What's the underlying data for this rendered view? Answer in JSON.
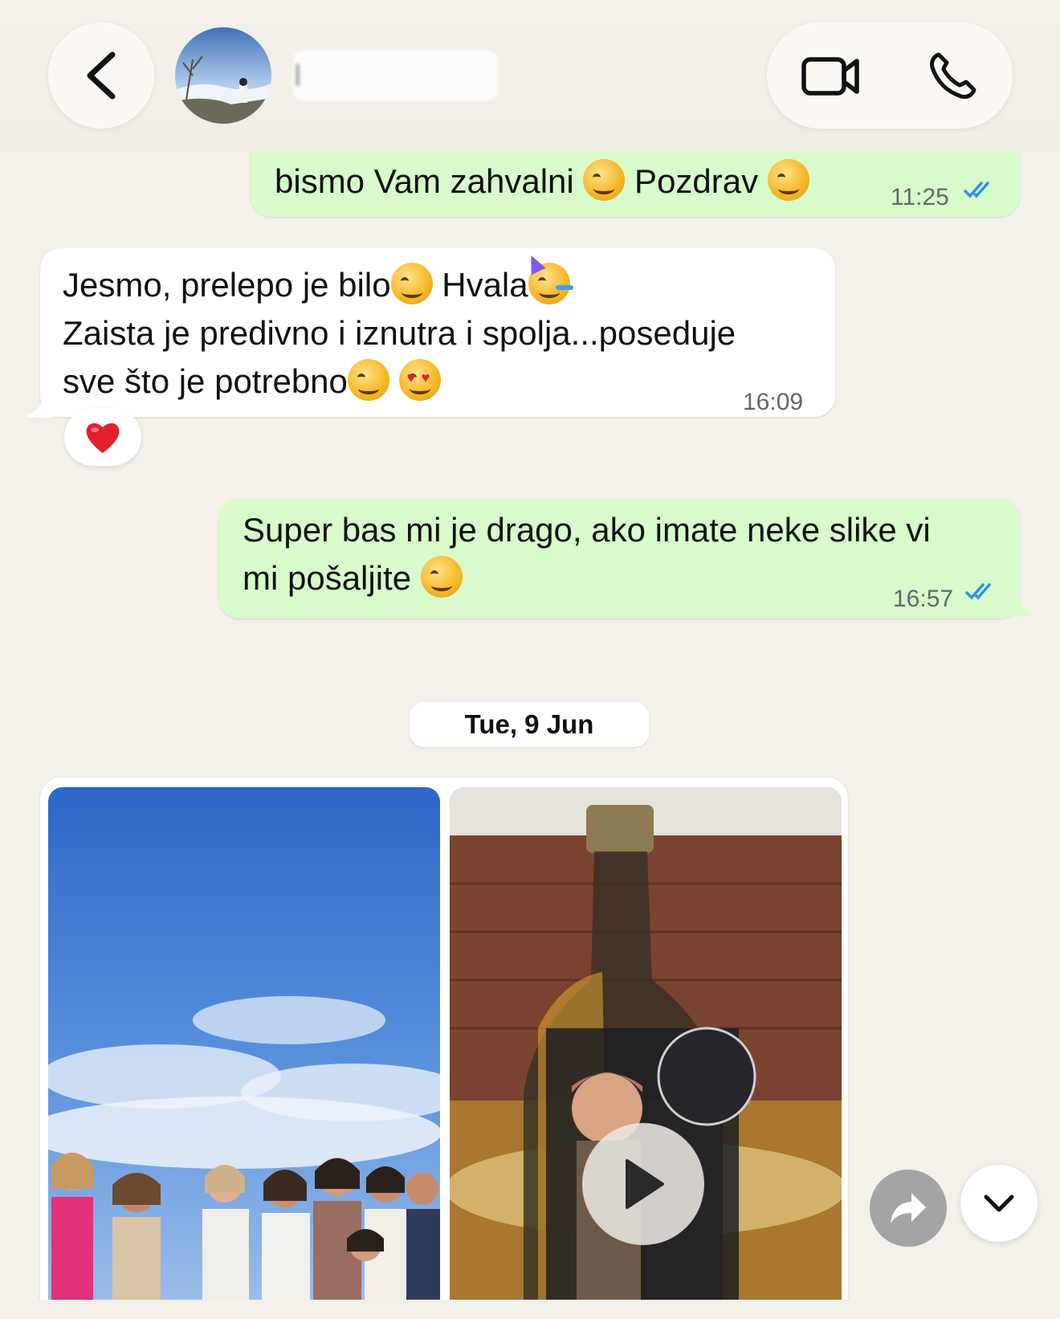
{
  "header": {
    "contact_name": "I",
    "back_icon": "chevron-left-icon",
    "video_call_icon": "video-camera-icon",
    "voice_call_icon": "phone-icon"
  },
  "messages": [
    {
      "direction": "out",
      "text_parts": [
        "bismo Vam zahvalni ",
        " Pozdrav "
      ],
      "emojis": [
        "smiling-face",
        "smiling-face"
      ],
      "time": "11:25",
      "status": "read"
    },
    {
      "direction": "in",
      "line1_a": "Jesmo, prelepo je bilo",
      "line1_b": " Hvala",
      "line2": "Zaista je predivno i iznutra i spolja...poseduje",
      "line3": "sve što je potrebno",
      "emojis": [
        "smiling-face",
        "party-face",
        "relieved-face",
        "heart-eyes-face"
      ],
      "time": "16:09",
      "reaction": "red-heart"
    },
    {
      "direction": "out",
      "line1": "Super bas mi je drago, ako imate neke slike vi",
      "line2": "mi pošaljite ",
      "emojis": [
        "smiling-face"
      ],
      "time": "16:57",
      "status": "read"
    }
  ],
  "date_separator": "Tue, 9 Jun",
  "media": {
    "items": [
      {
        "type": "photo",
        "description_icon": "group-photo"
      },
      {
        "type": "video",
        "description_icon": "bottle-video"
      }
    ]
  },
  "colors": {
    "background": "#f3efe9",
    "outgoing_bubble": "#d7fbcb",
    "incoming_bubble": "#ffffff",
    "read_ticks": "#2f8ef0"
  }
}
